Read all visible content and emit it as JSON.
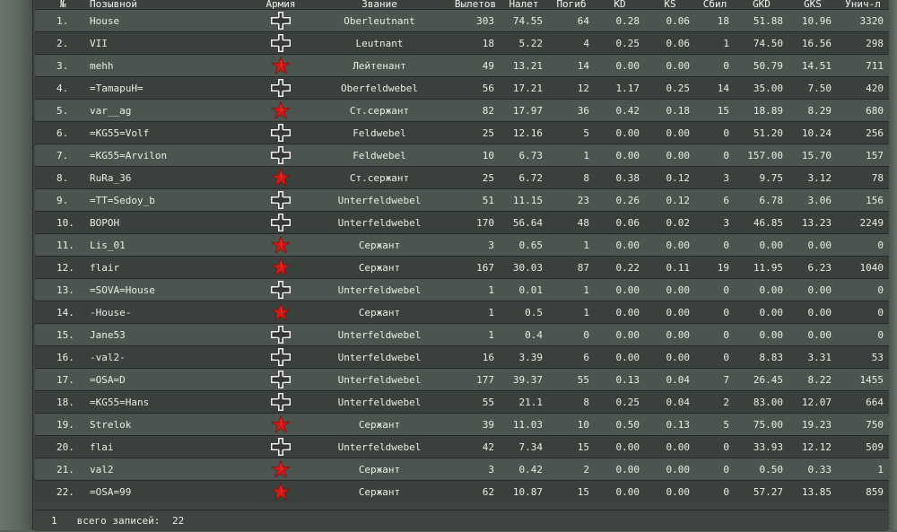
{
  "table": {
    "headers": [
      "№",
      "Позывной",
      "Армия",
      "Звание",
      "Вылетов",
      "Налет",
      "Погиб",
      "KD",
      "KS",
      "Сбил",
      "GKD",
      "GKS",
      "Унич-л"
    ],
    "rows": [
      {
        "n": "1.",
        "name": "House",
        "army": "axis",
        "rank": "Oberleutnant",
        "sorties": "303",
        "hours": "74.55",
        "deaths": "64",
        "kd": "0.28",
        "ks": "0.06",
        "kills": "18",
        "gkd": "51.88",
        "gks": "10.96",
        "destroyed": "3320"
      },
      {
        "n": "2.",
        "name": "VII",
        "army": "axis",
        "rank": "Leutnant",
        "sorties": "18",
        "hours": "5.22",
        "deaths": "4",
        "kd": "0.25",
        "ks": "0.06",
        "kills": "1",
        "gkd": "74.50",
        "gks": "16.56",
        "destroyed": "298"
      },
      {
        "n": "3.",
        "name": "mehh",
        "army": "soviet",
        "rank": "Лейтенант",
        "sorties": "49",
        "hours": "13.21",
        "deaths": "14",
        "kd": "0.00",
        "ks": "0.00",
        "kills": "0",
        "gkd": "50.79",
        "gks": "14.51",
        "destroyed": "711"
      },
      {
        "n": "4.",
        "name": "=TamapuH=",
        "army": "axis",
        "rank": "Oberfeldwebel",
        "sorties": "56",
        "hours": "17.21",
        "deaths": "12",
        "kd": "1.17",
        "ks": "0.25",
        "kills": "14",
        "gkd": "35.00",
        "gks": "7.50",
        "destroyed": "420"
      },
      {
        "n": "5.",
        "name": "var__ag",
        "army": "soviet",
        "rank": "Ст.сержант",
        "sorties": "82",
        "hours": "17.97",
        "deaths": "36",
        "kd": "0.42",
        "ks": "0.18",
        "kills": "15",
        "gkd": "18.89",
        "gks": "8.29",
        "destroyed": "680"
      },
      {
        "n": "6.",
        "name": "=KG55=Volf",
        "army": "axis",
        "rank": "Feldwebel",
        "sorties": "25",
        "hours": "12.16",
        "deaths": "5",
        "kd": "0.00",
        "ks": "0.00",
        "kills": "0",
        "gkd": "51.20",
        "gks": "10.24",
        "destroyed": "256"
      },
      {
        "n": "7.",
        "name": "=KG55=Arvilon",
        "army": "axis",
        "rank": "Feldwebel",
        "sorties": "10",
        "hours": "6.73",
        "deaths": "1",
        "kd": "0.00",
        "ks": "0.00",
        "kills": "0",
        "gkd": "157.00",
        "gks": "15.70",
        "destroyed": "157"
      },
      {
        "n": "8.",
        "name": "RuRa_36",
        "army": "soviet",
        "rank": "Ст.сержант",
        "sorties": "25",
        "hours": "6.72",
        "deaths": "8",
        "kd": "0.38",
        "ks": "0.12",
        "kills": "3",
        "gkd": "9.75",
        "gks": "3.12",
        "destroyed": "78"
      },
      {
        "n": "9.",
        "name": "=TT=Sedoy_b",
        "army": "axis",
        "rank": "Unterfeldwebel",
        "sorties": "51",
        "hours": "11.15",
        "deaths": "23",
        "kd": "0.26",
        "ks": "0.12",
        "kills": "6",
        "gkd": "6.78",
        "gks": "3.06",
        "destroyed": "156"
      },
      {
        "n": "10.",
        "name": "BOPOH",
        "army": "axis",
        "rank": "Unterfeldwebel",
        "sorties": "170",
        "hours": "56.64",
        "deaths": "48",
        "kd": "0.06",
        "ks": "0.02",
        "kills": "3",
        "gkd": "46.85",
        "gks": "13.23",
        "destroyed": "2249"
      },
      {
        "n": "11.",
        "name": "Lis_01",
        "army": "soviet",
        "rank": "Сержант",
        "sorties": "3",
        "hours": "0.65",
        "deaths": "1",
        "kd": "0.00",
        "ks": "0.00",
        "kills": "0",
        "gkd": "0.00",
        "gks": "0.00",
        "destroyed": "0"
      },
      {
        "n": "12.",
        "name": "flair",
        "army": "soviet",
        "rank": "Сержант",
        "sorties": "167",
        "hours": "30.03",
        "deaths": "87",
        "kd": "0.22",
        "ks": "0.11",
        "kills": "19",
        "gkd": "11.95",
        "gks": "6.23",
        "destroyed": "1040"
      },
      {
        "n": "13.",
        "name": "=SOVA=House",
        "army": "axis",
        "rank": "Unterfeldwebel",
        "sorties": "1",
        "hours": "0.01",
        "deaths": "1",
        "kd": "0.00",
        "ks": "0.00",
        "kills": "0",
        "gkd": "0.00",
        "gks": "0.00",
        "destroyed": "0"
      },
      {
        "n": "14.",
        "name": "-House-",
        "army": "soviet",
        "rank": "Сержант",
        "sorties": "1",
        "hours": "0.5",
        "deaths": "1",
        "kd": "0.00",
        "ks": "0.00",
        "kills": "0",
        "gkd": "0.00",
        "gks": "0.00",
        "destroyed": "0"
      },
      {
        "n": "15.",
        "name": "Jane53",
        "army": "axis",
        "rank": "Unterfeldwebel",
        "sorties": "1",
        "hours": "0.4",
        "deaths": "0",
        "kd": "0.00",
        "ks": "0.00",
        "kills": "0",
        "gkd": "0.00",
        "gks": "0.00",
        "destroyed": "0"
      },
      {
        "n": "16.",
        "name": "-val2-",
        "army": "axis",
        "rank": "Unterfeldwebel",
        "sorties": "16",
        "hours": "3.39",
        "deaths": "6",
        "kd": "0.00",
        "ks": "0.00",
        "kills": "0",
        "gkd": "8.83",
        "gks": "3.31",
        "destroyed": "53"
      },
      {
        "n": "17.",
        "name": "=OSA=D",
        "army": "axis",
        "rank": "Unterfeldwebel",
        "sorties": "177",
        "hours": "39.37",
        "deaths": "55",
        "kd": "0.13",
        "ks": "0.04",
        "kills": "7",
        "gkd": "26.45",
        "gks": "8.22",
        "destroyed": "1455"
      },
      {
        "n": "18.",
        "name": "=KG55=Hans",
        "army": "axis",
        "rank": "Unterfeldwebel",
        "sorties": "55",
        "hours": "21.1",
        "deaths": "8",
        "kd": "0.25",
        "ks": "0.04",
        "kills": "2",
        "gkd": "83.00",
        "gks": "12.07",
        "destroyed": "664"
      },
      {
        "n": "19.",
        "name": "Strelok",
        "army": "soviet",
        "rank": "Сержант",
        "sorties": "39",
        "hours": "11.03",
        "deaths": "10",
        "kd": "0.50",
        "ks": "0.13",
        "kills": "5",
        "gkd": "75.00",
        "gks": "19.23",
        "destroyed": "750"
      },
      {
        "n": "20.",
        "name": "flai",
        "army": "axis",
        "rank": "Unterfeldwebel",
        "sorties": "42",
        "hours": "7.34",
        "deaths": "15",
        "kd": "0.00",
        "ks": "0.00",
        "kills": "0",
        "gkd": "33.93",
        "gks": "12.12",
        "destroyed": "509"
      },
      {
        "n": "21.",
        "name": "val2",
        "army": "soviet",
        "rank": "Сержант",
        "sorties": "3",
        "hours": "0.42",
        "deaths": "2",
        "kd": "0.00",
        "ks": "0.00",
        "kills": "0",
        "gkd": "0.50",
        "gks": "0.33",
        "destroyed": "1"
      },
      {
        "n": "22.",
        "name": "=OSA=99",
        "army": "soviet",
        "rank": "Сержант",
        "sorties": "62",
        "hours": "10.87",
        "deaths": "15",
        "kd": "0.00",
        "ks": "0.00",
        "kills": "0",
        "gkd": "57.27",
        "gks": "13.85",
        "destroyed": "859"
      }
    ]
  },
  "footer": {
    "page": "1",
    "total_label": "всего записей:",
    "total": "22"
  },
  "icons": {
    "axis": "balkenkreuz-icon",
    "soviet": "red-star-icon"
  },
  "colors": {
    "red_star": "#d01818",
    "cross_outline": "#f0f0f0",
    "cross_fill": "#2a2a2a"
  }
}
